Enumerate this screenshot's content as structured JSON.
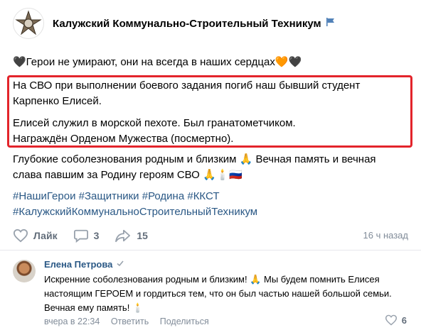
{
  "group": {
    "name": "Калужский Коммунально-Строительный Техникум"
  },
  "post": {
    "line1": "🖤Герои не умирают, они на всегда в наших сердцах🧡🖤",
    "highlight_p1": "На СВО при выполнении боевого задания погиб наш бывший студент Карпенко Елисей.",
    "highlight_p2a": "Елисей служил в морской пехоте. Был гранатометчиком.",
    "highlight_p2b": "Награждён Орденом Мужества (посмертно).",
    "body2": "Глубокие соболезнования родным и близким 🙏 Вечная память и вечная слава павшим за Родину героям СВО 🙏🕯️🇷🇺",
    "tags_line1": "#НашиГерои #Защитники #Родина #ККСТ",
    "tags_line2": "#КалужскийКоммунальноСтроительныйТехникум"
  },
  "actions": {
    "like_label": "Лайк",
    "comments_count": "3",
    "shares_count": "15",
    "time": "16 ч назад"
  },
  "comment": {
    "author": "Елена Петрова",
    "text": "Искренние соболезнования родным и близким! 🙏 Мы будем помнить Елисея настоящим ГЕРОЕМ и гордиться тем, что он был частью нашей большой семьи. Вечная ему память! 🕯️",
    "time": "вчера в 22:34",
    "reply_label": "Ответить",
    "share_label": "Поделиться",
    "likes": "6"
  },
  "colors": {
    "link": "#2a5885",
    "highlight_border": "#e3242b",
    "muted": "#818c99"
  },
  "icons": [
    "college-emblem-icon",
    "flag-icon",
    "heart-outline-icon",
    "comment-icon",
    "share-arrow-icon",
    "verified-check-icon"
  ]
}
